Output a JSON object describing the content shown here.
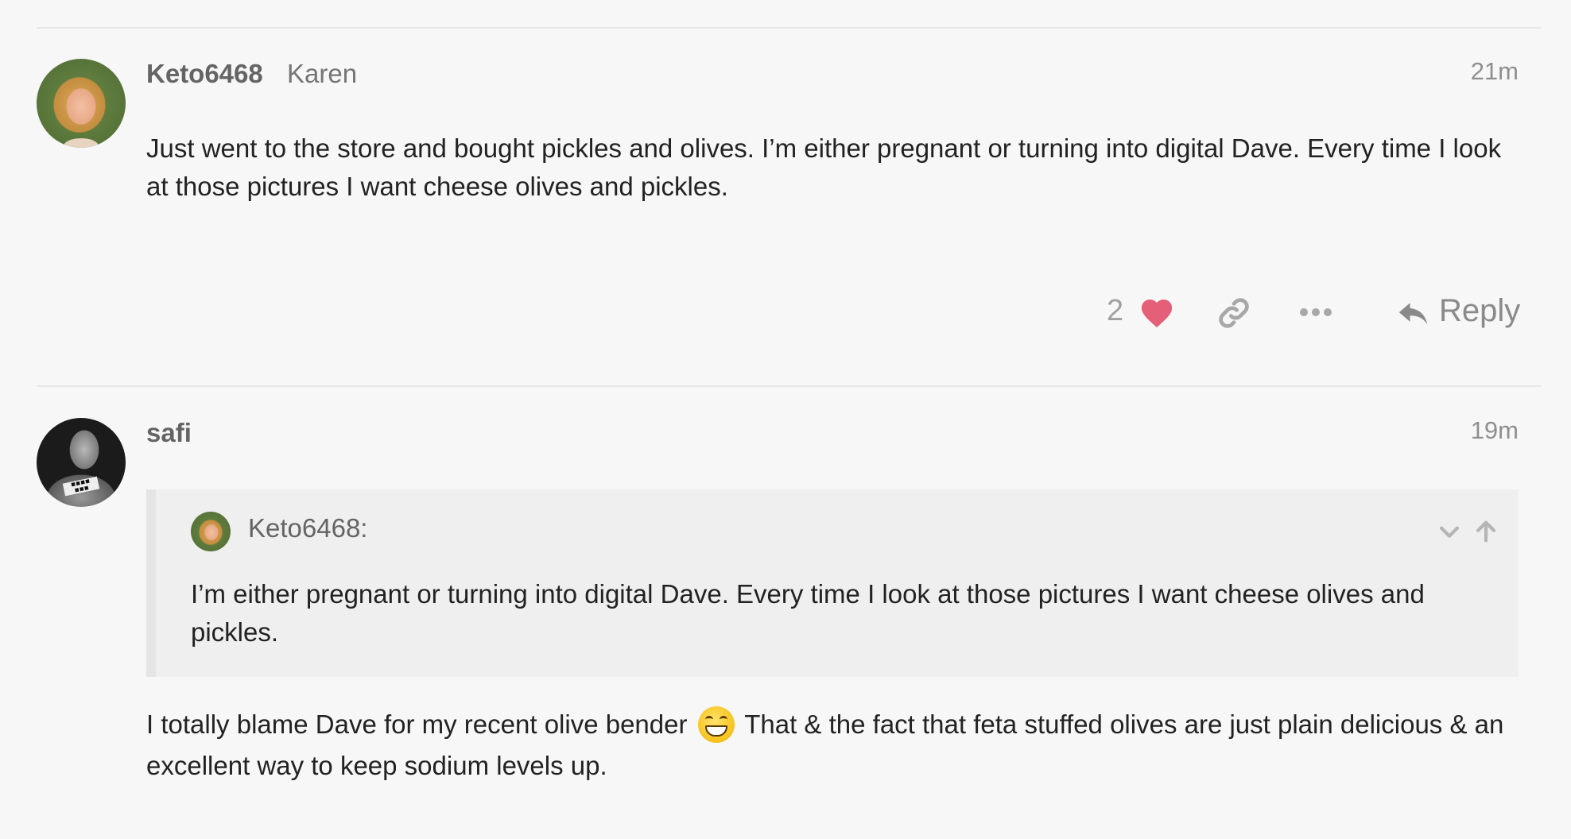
{
  "posts": [
    {
      "username": "Keto6468",
      "full_name": "Karen",
      "time": "21m",
      "body": "Just went to the store and bought pickles and olives. I’m either pregnant or turning into digital Dave. Every time I look at those pictures I want cheese olives and pickles.",
      "actions": {
        "like_count": "2",
        "reply_label": "Reply",
        "like_color": "#e45f77"
      }
    },
    {
      "username": "safi",
      "time": "19m",
      "quote": {
        "username": "Keto6468:",
        "text": "I’m either pregnant or turning into digital Dave. Every time I look at those pictures I want cheese olives and pickles."
      },
      "body_part1": "I totally blame Dave for my recent olive bender",
      "emoji": "grinning-face-emoji",
      "body_part2": "That & the fact that feta stuffed olives are just plain delicious & an excellent way to keep sodium levels up."
    }
  ],
  "icons": {
    "heart": "heart-icon",
    "link": "link-icon",
    "more": "more-icon",
    "reply": "reply-arrow-icon",
    "collapse": "chevron-down-icon",
    "expand": "arrow-up-icon"
  }
}
